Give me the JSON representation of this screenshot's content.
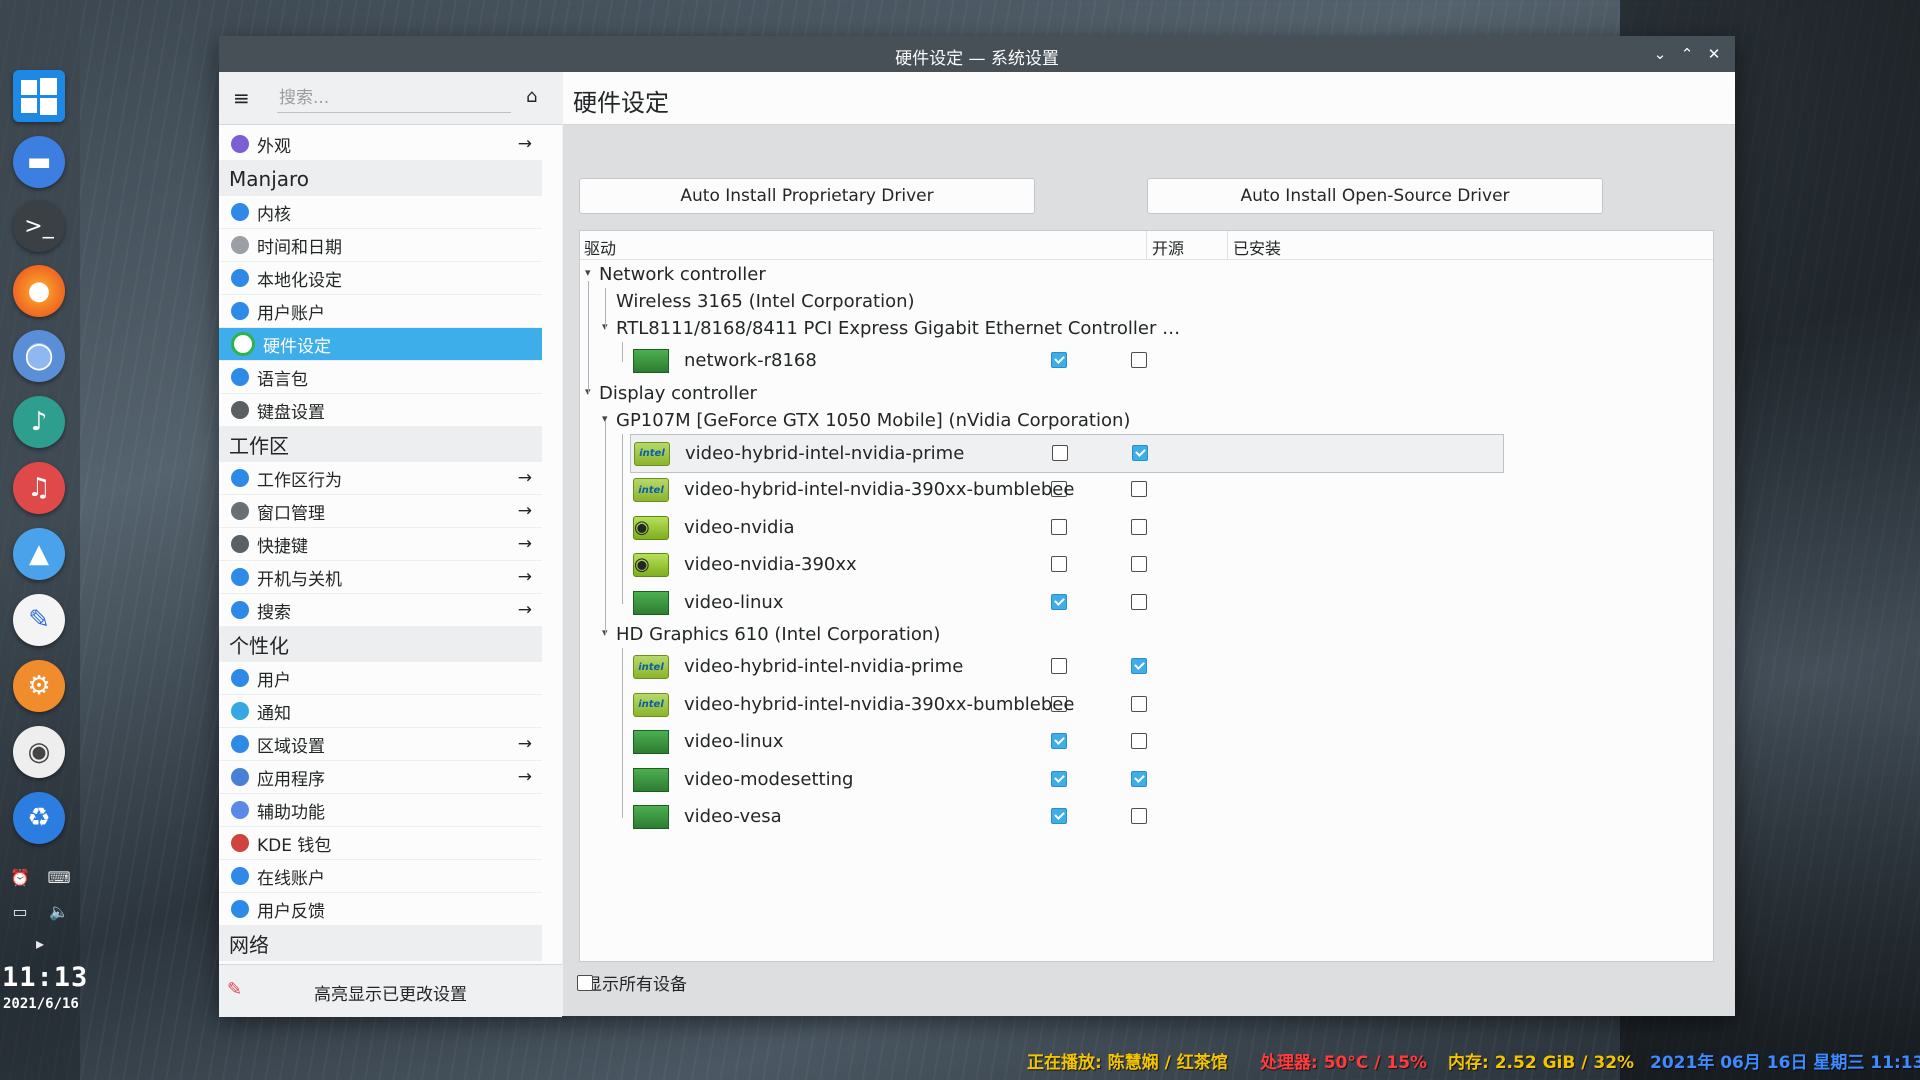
{
  "window": {
    "title": "硬件设定 — 系统设置"
  },
  "sidebar": {
    "search_placeholder": "搜索...",
    "items": [
      {
        "label": "外观",
        "icon": "appearance-icon",
        "arrow": true,
        "type": "item"
      },
      {
        "label": "Manjaro",
        "type": "category"
      },
      {
        "label": "内核",
        "icon": "kernel-icon",
        "type": "item"
      },
      {
        "label": "时间和日期",
        "icon": "clock-icon",
        "type": "item"
      },
      {
        "label": "本地化设定",
        "icon": "locale-icon",
        "type": "item"
      },
      {
        "label": "用户账户",
        "icon": "user-account-icon",
        "type": "item"
      },
      {
        "label": "硬件设定",
        "icon": "hardware-icon",
        "type": "item",
        "selected": true
      },
      {
        "label": "语言包",
        "icon": "language-icon",
        "type": "item"
      },
      {
        "label": "键盘设置",
        "icon": "keyboard-icon",
        "type": "item"
      },
      {
        "label": "工作区",
        "type": "category"
      },
      {
        "label": "工作区行为",
        "icon": "workspace-icon",
        "arrow": true,
        "type": "item"
      },
      {
        "label": "窗口管理",
        "icon": "window-manage-icon",
        "arrow": true,
        "type": "item"
      },
      {
        "label": "快捷键",
        "icon": "shortcut-icon",
        "arrow": true,
        "type": "item"
      },
      {
        "label": "开机与关机",
        "icon": "power-icon",
        "arrow": true,
        "type": "item"
      },
      {
        "label": "搜索",
        "icon": "search-icon",
        "arrow": true,
        "type": "item"
      },
      {
        "label": "个性化",
        "type": "category"
      },
      {
        "label": "用户",
        "icon": "user-icon",
        "type": "item"
      },
      {
        "label": "通知",
        "icon": "notification-icon",
        "type": "item"
      },
      {
        "label": "区域设置",
        "icon": "region-icon",
        "arrow": true,
        "type": "item"
      },
      {
        "label": "应用程序",
        "icon": "applications-icon",
        "arrow": true,
        "type": "item"
      },
      {
        "label": "辅助功能",
        "icon": "accessibility-icon",
        "type": "item"
      },
      {
        "label": "KDE 钱包",
        "icon": "wallet-icon",
        "type": "item"
      },
      {
        "label": "在线账户",
        "icon": "online-accounts-icon",
        "type": "item"
      },
      {
        "label": "用户反馈",
        "icon": "feedback-icon",
        "type": "item"
      },
      {
        "label": "网络",
        "type": "category"
      }
    ],
    "footer_label": "高亮显示已更改设置"
  },
  "content": {
    "page_title": "硬件设定",
    "btn_proprietary": "Auto Install Proprietary Driver",
    "btn_opensource": "Auto Install Open-Source Driver",
    "columns": {
      "driver": "驱动",
      "open_source": "开源",
      "installed": "已安装"
    },
    "tree": [
      {
        "depth": 0,
        "kind": "group",
        "label": "Network controller",
        "expanded": true
      },
      {
        "depth": 1,
        "kind": "device",
        "label": "Wireless 3165 (Intel Corporation)"
      },
      {
        "depth": 1,
        "kind": "group",
        "label": "RTL8111/8168/8411 PCI Express Gigabit Ethernet Controller …",
        "expanded": true
      },
      {
        "depth": 2,
        "kind": "driver",
        "label": "network-r8168",
        "icon": "network-card-icon",
        "open": true,
        "installed": false
      },
      {
        "depth": 0,
        "kind": "group",
        "label": "Display controller",
        "expanded": true
      },
      {
        "depth": 1,
        "kind": "group",
        "label": "GP107M [GeForce GTX 1050 Mobile] (nVidia Corporation)",
        "expanded": true
      },
      {
        "depth": 2,
        "kind": "driver",
        "label": "video-hybrid-intel-nvidia-prime",
        "icon": "intel-icon",
        "open": false,
        "installed": true,
        "selected": true
      },
      {
        "depth": 2,
        "kind": "driver",
        "label": "video-hybrid-intel-nvidia-390xx-bumblebee",
        "icon": "intel-icon",
        "open": false,
        "installed": false
      },
      {
        "depth": 2,
        "kind": "driver",
        "label": "video-nvidia",
        "icon": "nvidia-icon",
        "open": false,
        "installed": false
      },
      {
        "depth": 2,
        "kind": "driver",
        "label": "video-nvidia-390xx",
        "icon": "nvidia-icon",
        "open": false,
        "installed": false
      },
      {
        "depth": 2,
        "kind": "driver",
        "label": "video-linux",
        "icon": "video-card-icon",
        "open": true,
        "installed": false
      },
      {
        "depth": 1,
        "kind": "group",
        "label": "HD Graphics 610 (Intel Corporation)",
        "expanded": true
      },
      {
        "depth": 2,
        "kind": "driver",
        "label": "video-hybrid-intel-nvidia-prime",
        "icon": "intel-icon",
        "open": false,
        "installed": true
      },
      {
        "depth": 2,
        "kind": "driver",
        "label": "video-hybrid-intel-nvidia-390xx-bumblebee",
        "icon": "intel-icon",
        "open": false,
        "installed": false
      },
      {
        "depth": 2,
        "kind": "driver",
        "label": "video-linux",
        "icon": "video-card-icon",
        "open": true,
        "installed": false
      },
      {
        "depth": 2,
        "kind": "driver",
        "label": "video-modesetting",
        "icon": "video-card-icon",
        "open": true,
        "installed": true
      },
      {
        "depth": 2,
        "kind": "driver",
        "label": "video-vesa",
        "icon": "video-card-icon",
        "open": true,
        "installed": false
      }
    ],
    "show_all_label": "显示所有设备",
    "show_all_checked": false
  },
  "dock": {
    "apps": [
      "windows-logo-icon",
      "file-manager-icon",
      "terminal-icon",
      "firefox-icon",
      "chrome-icon",
      "music-player-icon",
      "headphones-icon",
      "image-viewer-icon",
      "text-editor-icon",
      "settings-icon",
      "disc-icon",
      "recycle-icon"
    ],
    "clock_time": "11:13",
    "clock_date": "2021/6/16"
  },
  "statusbar": {
    "now_playing": "正在播放: 陈慧娴 / 红茶馆",
    "cpu": "处理器: 50°C / 15%",
    "memory": "内存: 2.52 GiB / 32%",
    "datetime": "2021年 06月 16日 星期三 11:13",
    "colors": {
      "now_playing": "#f5c400",
      "cpu": "#ff3b3b",
      "memory": "#f5c400",
      "datetime": "#3d8bff"
    }
  },
  "colors": {
    "accent": "#3daee9",
    "titlebar": "#475057"
  }
}
